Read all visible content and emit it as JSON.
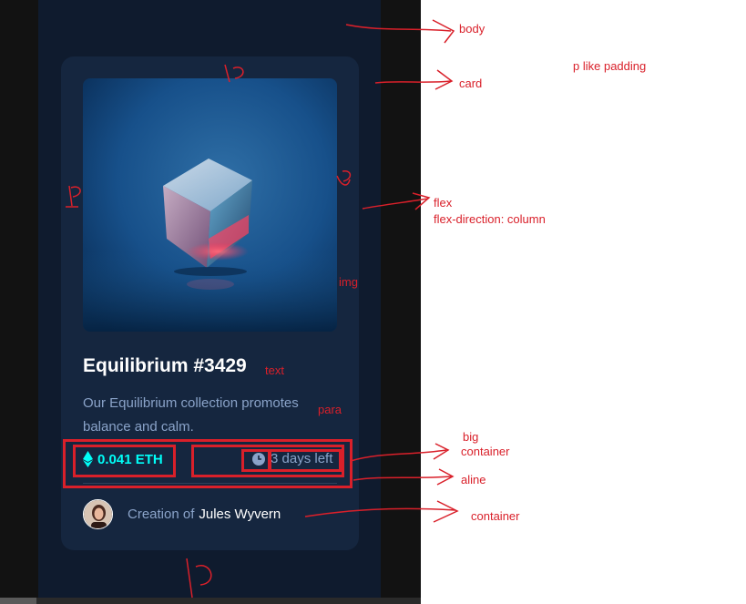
{
  "card": {
    "title": "Equilibrium #3429",
    "description": "Our Equilibrium collection promotes balance and calm.",
    "price": "0.041 ETH",
    "time_left": "3 days left",
    "creator_prefix": "Creation of",
    "creator_name": "Jules Wyvern",
    "image_icon": "cube-image",
    "price_icon": "ethereum-icon",
    "time_icon": "clock-icon"
  },
  "annotations": {
    "body": "body",
    "card": "card",
    "padding_note": "p like padding",
    "flex": "flex",
    "flex_direction": "flex-direction: column",
    "img": "img",
    "text": "text",
    "para": "para",
    "big": "big",
    "container_big": "container",
    "aline": "aline",
    "container": "container",
    "p_top": "1p",
    "p_left": "P",
    "p_right": "P",
    "p_bottom": "1P"
  },
  "colors": {
    "page_background": "#0f1b2e",
    "card_background": "#15263f",
    "accent_cyan": "#00fff8",
    "soft_blue": "#8aa3c9",
    "annotation_red": "#d9202a"
  }
}
